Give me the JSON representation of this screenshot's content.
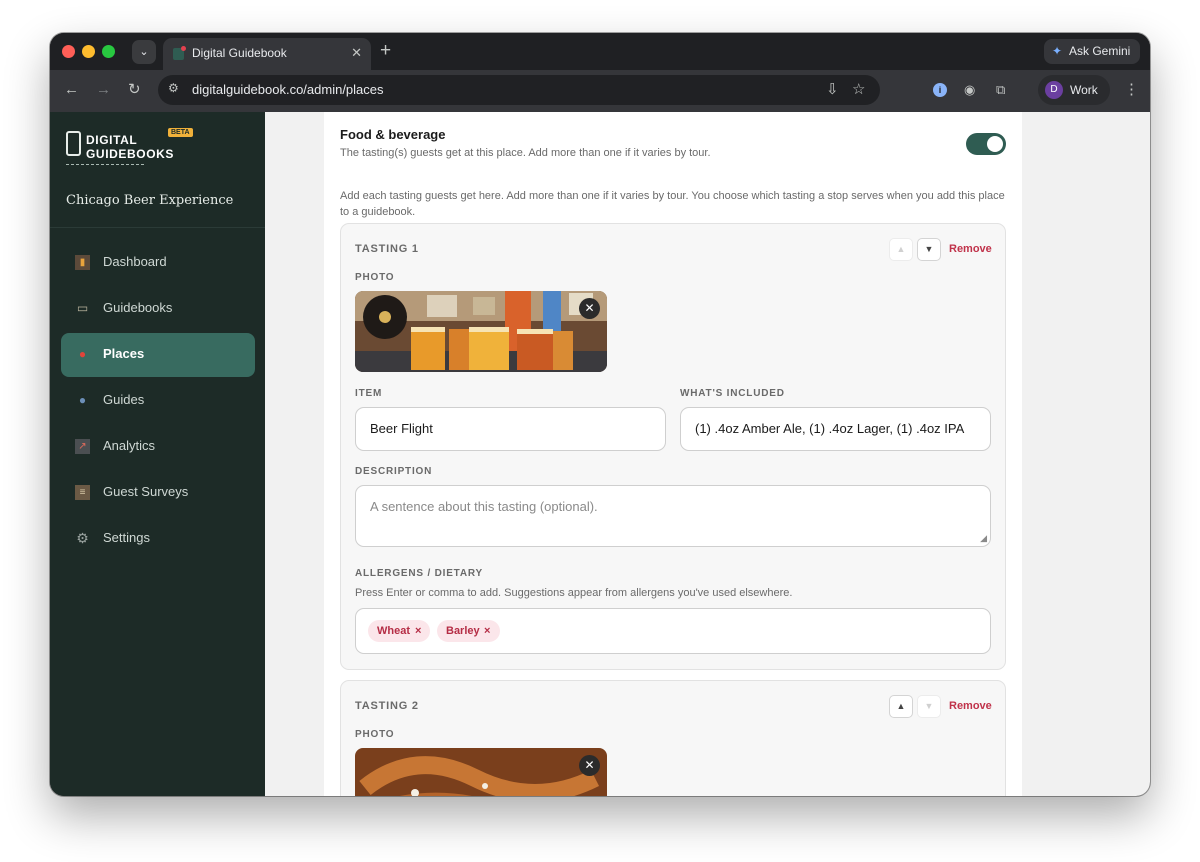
{
  "browser": {
    "tab_title": "Digital Guidebook",
    "tab_close": "✕",
    "new_tab": "+",
    "url": "digitalguidebook.co/admin/places",
    "gemini_label": "Ask Gemini",
    "profile_initial": "D",
    "profile_label": "Work"
  },
  "sidebar": {
    "logo_line1": "DIGITAL",
    "logo_line2": "GUIDEBOOKS",
    "logo_badge": "BETA",
    "org_name": "Chicago Beer Experience",
    "items": [
      {
        "label": "Dashboard",
        "icon": "bar-chart-icon"
      },
      {
        "label": "Guidebooks",
        "icon": "book-icon"
      },
      {
        "label": "Places",
        "icon": "pin-icon",
        "active": true
      },
      {
        "label": "Guides",
        "icon": "people-icon"
      },
      {
        "label": "Analytics",
        "icon": "trend-chart-icon"
      },
      {
        "label": "Guest Surveys",
        "icon": "clipboard-icon"
      },
      {
        "label": "Settings",
        "icon": "gear-icon"
      }
    ]
  },
  "section": {
    "title": "Food & beverage",
    "subtitle": "The tasting(s) guests get at this place. Add more than one if it varies by tour.",
    "toggle_on": true,
    "intro": "Add each tasting guests get here. Add more than one if it varies by tour. You choose which tasting a stop serves when you add this place to a guidebook."
  },
  "tastings": [
    {
      "title": "TASTING 1",
      "remove_label": "Remove",
      "move_up_label": "▲",
      "move_down_label": "▼",
      "photo_label": "PHOTO",
      "photo_remove": "✕",
      "item_label": "ITEM",
      "item_value": "Beer Flight",
      "included_label": "WHAT'S INCLUDED",
      "included_value": "(1) .4oz Amber Ale, (1) .4oz Lager, (1) .4oz IPA",
      "description_label": "DESCRIPTION",
      "description_placeholder": "A sentence about this tasting (optional).",
      "allergens_label": "ALLERGENS / DIETARY",
      "allergens_hint": "Press Enter or comma to add. Suggestions appear from allergens you've used elsewhere.",
      "allergens": [
        "Wheat",
        "Barley"
      ],
      "tag_remove": "×"
    },
    {
      "title": "TASTING 2",
      "remove_label": "Remove",
      "move_up_label": "▲",
      "move_down_label": "▼",
      "photo_label": "PHOTO",
      "photo_remove": "✕"
    }
  ],
  "colors": {
    "sidebar_bg": "#1d2b27",
    "active_nav": "#386b60",
    "toggle_on": "#2f5c52",
    "danger": "#c0324a",
    "chip_bg": "#fbe6ea"
  }
}
